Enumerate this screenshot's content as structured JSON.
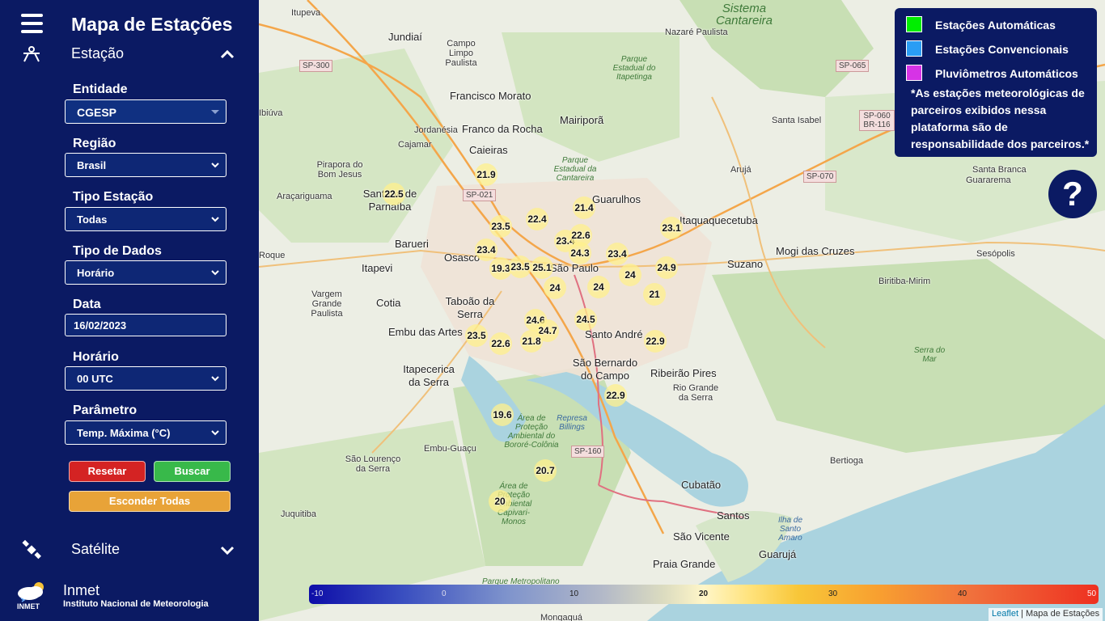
{
  "app": {
    "title": "Mapa de Estações"
  },
  "sections": {
    "estacao": {
      "label": "Estação",
      "icon": "station-icon",
      "state": "expanded"
    },
    "satelite": {
      "label": "Satélite",
      "icon": "satellite-icon",
      "state": "collapsed"
    }
  },
  "form": {
    "entidade": {
      "label": "Entidade",
      "value": "CGESP"
    },
    "regiao": {
      "label": "Região",
      "value": "Brasil"
    },
    "tipo_estacao": {
      "label": "Tipo Estação",
      "value": "Todas"
    },
    "tipo_dados": {
      "label": "Tipo de Dados",
      "value": "Horário"
    },
    "data": {
      "label": "Data",
      "value": "16/02/2023"
    },
    "horario": {
      "label": "Horário",
      "value": "00 UTC"
    },
    "parametro": {
      "label": "Parâmetro",
      "value": "Temp. Máxima (°C)"
    }
  },
  "buttons": {
    "resetar": "Resetar",
    "buscar": "Buscar",
    "esconder": "Esconder Todas"
  },
  "footer": {
    "logo_text": "INMET",
    "name": "Inmet",
    "subtitle": "Instituto Nacional de Meteorologia"
  },
  "legend": {
    "items": [
      {
        "label": "Estações Automáticas",
        "color": "#00ee00"
      },
      {
        "label": "Estações Convencionais",
        "color": "#2a9df4"
      },
      {
        "label": "Pluviômetros Automáticos",
        "color": "#d633e6"
      }
    ],
    "note": "*As estações meteorológicas de parceiros exibidos nessa plataforma são de responsabilidade dos parceiros.*"
  },
  "help": {
    "label": "?"
  },
  "map": {
    "places": [
      "Itupeva",
      "Jundiaí",
      "Campo Limpo Paulista",
      "Nazaré Paulista",
      "Francisco Morato",
      "Franco da Rocha",
      "Mairiporã",
      "Caieiras",
      "Jordanésia",
      "Cajamar",
      "Pirapora do Bom Jesus",
      "Araçariguama",
      "Santana de Parnaíba",
      "Barueri",
      "Guarulhos",
      "Itaquaquecetuba",
      "Arujá",
      "Santa Isabel",
      "Santa Branca",
      "Guararema",
      "Osasco",
      "São Paulo",
      "Itapevi",
      "Suzano",
      "Mogi das Cruzes",
      "Sesópolis",
      "Biritiba-Mirim",
      "Vargem Grande Paulista",
      "Cotia",
      "Taboão da Serra",
      "Embu das Artes",
      "Santo André",
      "Itapecerica da Serra",
      "São Bernardo do Campo",
      "Ribeirão Pires",
      "Rio Grande da Serra",
      "Embu-Guaçu",
      "São Lourenço da Serra",
      "Juquitiba",
      "Cubatão",
      "Santos",
      "São Vicente",
      "Praia Grande",
      "Guarujá",
      "Bertioga",
      "Mongaguá",
      "Roque",
      "Ibiúva",
      "Ilha de Santo Amaro"
    ],
    "green_areas": [
      "Sistema Cantareira",
      "Parque Estadual do Itapetinga",
      "Parque Estadual da Cantareira",
      "Área de Proteção Ambiental do Bororé-Colônia",
      "Área de Proteção Ambiental Capivari-Monos",
      "Serra do Mar",
      "Parque Metropolitano"
    ],
    "water": [
      "Represa Billings"
    ],
    "roads": [
      "SP-300",
      "SP-065",
      "SP-021",
      "SP-070",
      "SP-060 BR-116",
      "SP-160"
    ],
    "stations": [
      {
        "value": "21.9"
      },
      {
        "value": "22.5"
      },
      {
        "value": "23.5"
      },
      {
        "value": "22.4"
      },
      {
        "value": "21.4"
      },
      {
        "value": "23.1"
      },
      {
        "value": "23.4"
      },
      {
        "value": "22.6"
      },
      {
        "value": "23.4"
      },
      {
        "value": "24.3"
      },
      {
        "value": "23.4"
      },
      {
        "value": "24.9"
      },
      {
        "value": "19.3"
      },
      {
        "value": "23.5"
      },
      {
        "value": "25.1"
      },
      {
        "value": "24"
      },
      {
        "value": "24"
      },
      {
        "value": "24"
      },
      {
        "value": "21"
      },
      {
        "value": "24.6"
      },
      {
        "value": "24.5"
      },
      {
        "value": "24.7"
      },
      {
        "value": "23.5"
      },
      {
        "value": "22.6"
      },
      {
        "value": "21.8"
      },
      {
        "value": "22.9"
      },
      {
        "value": "22.9"
      },
      {
        "value": "19.6"
      },
      {
        "value": "20.7"
      },
      {
        "value": "20"
      }
    ]
  },
  "colorbar": {
    "ticks": [
      "-10",
      "0",
      "10",
      "20",
      "30",
      "40",
      "50"
    ]
  },
  "attribution": {
    "leaflet": "Leaflet",
    "separator": " | ",
    "credit": "Mapa de Estações"
  }
}
